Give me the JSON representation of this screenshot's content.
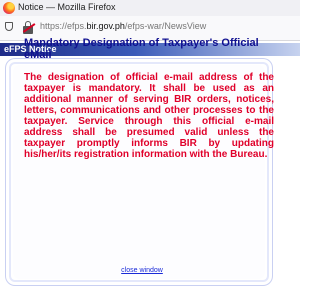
{
  "window": {
    "title": "Notice — Mozilla Firefox"
  },
  "address_bar": {
    "url_prefix": "https://efps.",
    "url_host": "bir.gov.ph",
    "url_path": "/efps-war/NewsView"
  },
  "page": {
    "section_label": "eFPS Notice",
    "heading": "Mandatory Designation of Taxpayer's Official eMail",
    "body": "The designation of official e-mail address of the taxpayer is mandatory. It shall be used as an additional manner of serving BIR orders, notices, letters, communications and other processes to the taxpayer. Service through this official e-mail address shall be presumed valid unless the taxpayer promptly informs BIR by updating his/her/its registration information with the Bureau.",
    "close_link": "close window"
  },
  "colors": {
    "heading": "#101090",
    "body_text": "#e0002a",
    "link": "#1a2ad8",
    "banner_dark": "#1f2c88"
  }
}
